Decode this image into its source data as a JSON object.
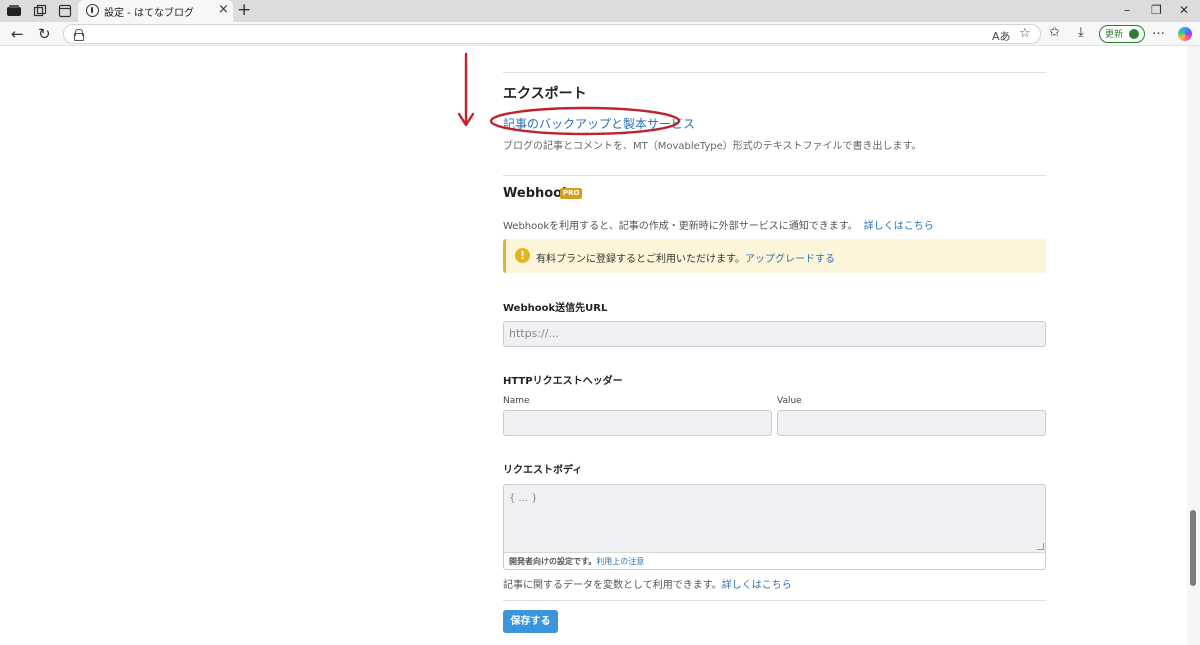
{
  "browser": {
    "tab_title": "設定 - はてなブログ",
    "tab_close": "×",
    "new_tab": "+",
    "window_controls": [
      "–",
      "❐",
      "✕"
    ],
    "nav": {
      "back": "←",
      "reload": "↻"
    },
    "url_text": "",
    "read_aloud": "Aあ",
    "update_label": "更新"
  },
  "export": {
    "heading": "エクスポート",
    "link": "記事のバックアップと製本サービス",
    "description": "ブログの記事とコメントを、MT（MovableType）形式のテキストファイルで書き出します。"
  },
  "webhook": {
    "heading": "Webhook",
    "badge": "PRO",
    "description": "Webhookを利用すると、記事の作成・更新時に外部サービスに通知できます。",
    "learn_more": "詳しくはこちら",
    "notice_icon": "!",
    "notice_text": "有料プランに登録するとご利用いただけます。",
    "notice_link": "アップグレードする",
    "url_label": "Webhook送信先URL",
    "url_placeholder": "https://...",
    "headers_label": "HTTPリクエストヘッダー",
    "name_label": "Name",
    "value_label": "Value",
    "body_label": "リクエストボディ",
    "body_placeholder": "{ ... }",
    "body_footer_text": "開発者向けの設定です。",
    "body_footer_link": "利用上の注意",
    "vars_text": "記事に関するデータを変数として利用できます。",
    "vars_link": "詳しくはこちら",
    "save_label": "保存する"
  },
  "colors": {
    "annotation_red": "#c0232b",
    "link_blue": "#2b6fb6",
    "pro_gold": "#d4a01c",
    "save_blue": "#3b95dd",
    "notice_bg": "#fdf5d9"
  }
}
